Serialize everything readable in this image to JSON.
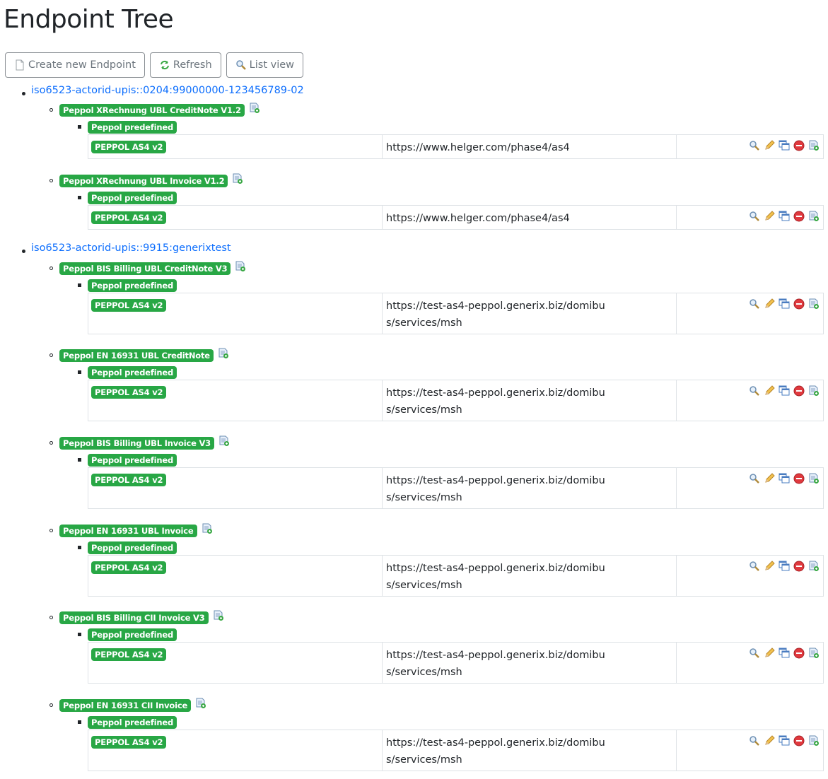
{
  "page": {
    "title": "Endpoint Tree"
  },
  "toolbar": {
    "create_label": "Create new Endpoint",
    "refresh_label": "Refresh",
    "list_view_label": "List view"
  },
  "participants": [
    {
      "id": "iso6523-actorid-upis::0204:99000000-123456789-02",
      "documents": [
        {
          "name": "Peppol XRechnung UBL CreditNote V1.2",
          "process": "Peppol predefined",
          "transport": "PEPPOL AS4 v2",
          "url": "https://www.helger.com/phase4/as4"
        },
        {
          "name": "Peppol XRechnung UBL Invoice V1.2",
          "process": "Peppol predefined",
          "transport": "PEPPOL AS4 v2",
          "url": "https://www.helger.com/phase4/as4"
        }
      ]
    },
    {
      "id": "iso6523-actorid-upis::9915:generixtest",
      "documents": [
        {
          "name": "Peppol BIS Billing UBL CreditNote V3",
          "process": "Peppol predefined",
          "transport": "PEPPOL AS4 v2",
          "url": "https://test-as4-peppol.generix.biz/domibus/services/msh"
        },
        {
          "name": "Peppol EN 16931 UBL CreditNote",
          "process": "Peppol predefined",
          "transport": "PEPPOL AS4 v2",
          "url": "https://test-as4-peppol.generix.biz/domibus/services/msh"
        },
        {
          "name": "Peppol BIS Billing UBL Invoice V3",
          "process": "Peppol predefined",
          "transport": "PEPPOL AS4 v2",
          "url": "https://test-as4-peppol.generix.biz/domibus/services/msh"
        },
        {
          "name": "Peppol EN 16931 UBL Invoice",
          "process": "Peppol predefined",
          "transport": "PEPPOL AS4 v2",
          "url": "https://test-as4-peppol.generix.biz/domibus/services/msh"
        },
        {
          "name": "Peppol BIS Billing CII Invoice V3",
          "process": "Peppol predefined",
          "transport": "PEPPOL AS4 v2",
          "url": "https://test-as4-peppol.generix.biz/domibus/services/msh"
        },
        {
          "name": "Peppol EN 16931 CII Invoice",
          "process": "Peppol predefined",
          "transport": "PEPPOL AS4 v2",
          "url": "https://test-as4-peppol.generix.biz/domibus/services/msh"
        }
      ]
    }
  ],
  "icons": {
    "create": "new-document-icon",
    "refresh": "refresh-icon",
    "list_view": "magnifier-icon",
    "doc_action": "add-endpoint-icon",
    "actions": [
      "view-icon",
      "edit-icon",
      "copy-icon",
      "delete-icon",
      "add-icon"
    ]
  },
  "colors": {
    "link": "#0d6efd",
    "badge": "#28a745",
    "border": "#dee2e6"
  }
}
